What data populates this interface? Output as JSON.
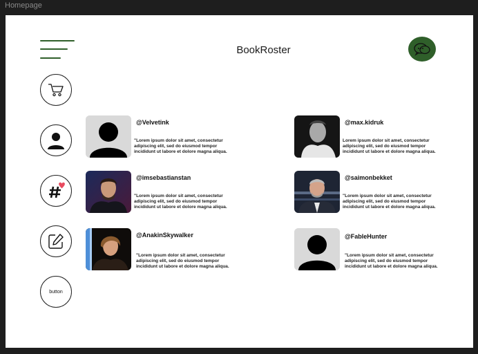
{
  "frame": {
    "label": "Homepage"
  },
  "header": {
    "title": "BookRoster",
    "menu_icon": "hamburger-menu-icon",
    "chat_icon": "chat-bubbles-icon",
    "accent_color": "#2f5f2a"
  },
  "sidebar": {
    "items": [
      {
        "icon": "cart-icon"
      },
      {
        "icon": "user-icon"
      },
      {
        "icon": "hashtag-heart-icon"
      },
      {
        "icon": "edit-icon"
      },
      {
        "label": "button"
      }
    ]
  },
  "profiles": [
    {
      "handle": "@Velvetink",
      "description": "\"Lorem ipsum dolor sit amet, consectetur adipiscing elit, sed do eiusmod tempor incididunt ut labore et dolore magna aliqua.",
      "avatar": "default-avatar"
    },
    {
      "handle": "@max.kidruk",
      "description": "Lorem ipsum dolor sit amet, consectetur adipiscing elit, sed do eiusmod tempor incididunt ut labore et dolore magna aliqua.",
      "avatar": "photo"
    },
    {
      "handle": "@imsebastianstan",
      "description": "\"Lorem ipsum dolor sit amet, consectetur adipiscing elit, sed do eiusmod tempor incididunt ut labore et dolore magna aliqua.",
      "avatar": "photo"
    },
    {
      "handle": "@saimonbekket",
      "description": "\"Lorem ipsum dolor sit amet, consectetur adipiscing elit, sed do eiusmod tempor incididunt ut labore et dolore magna aliqua.",
      "avatar": "photo"
    },
    {
      "handle": "@AnakinSkywalker",
      "description": "\"Lorem ipsum dolor sit amet, consectetur adipiscing elit, sed do eiusmod tempor incididunt ut labore et dolore magna aliqua.",
      "avatar": "photo"
    },
    {
      "handle": "@FableHunter",
      "description": "\"Lorem ipsum dolor sit amet, consectetur adipiscing elit, sed do eiusmod tempor incididunt ut labore et dolore magna aliqua.",
      "avatar": "default-avatar"
    }
  ]
}
